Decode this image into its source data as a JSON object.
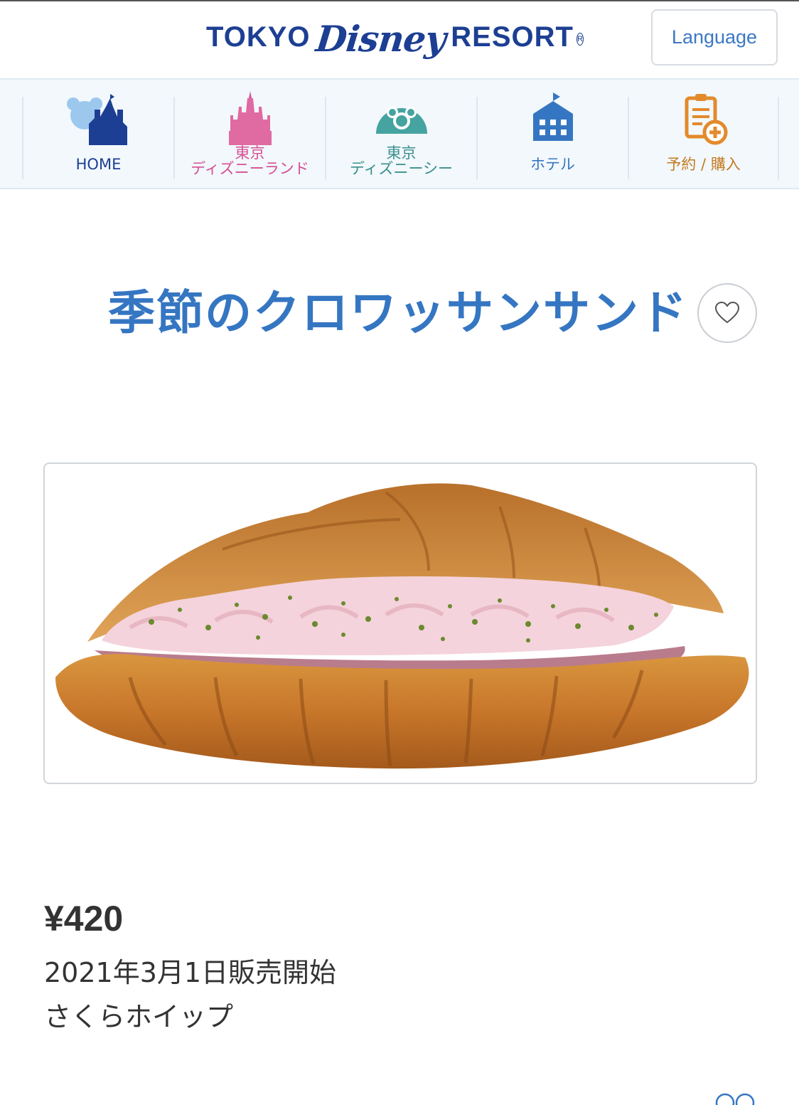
{
  "header": {
    "logo": {
      "part1": "TOKYO",
      "part2": "Disney",
      "part3": "RESORT",
      "registered": "R"
    },
    "language_label": "Language"
  },
  "nav": {
    "items": [
      {
        "label": "HOME",
        "icon": "castle-home-icon",
        "color": "#1d3f93"
      },
      {
        "label_top": "東京",
        "label_bottom": "ディズニーランド",
        "icon": "pink-castle-icon",
        "color": "#d64f93"
      },
      {
        "label_top": "東京",
        "label_bottom": "ディズニーシー",
        "icon": "mickey-globe-icon",
        "color": "#3b8f8c"
      },
      {
        "label": "ホテル",
        "icon": "hotel-icon",
        "color": "#3576c2"
      },
      {
        "label": "予約 / 購入",
        "icon": "clipboard-plus-icon",
        "color": "#c57a22"
      }
    ]
  },
  "product": {
    "title": "季節のクロワッサンサンド",
    "image_alt": "product-photo",
    "price": "¥420",
    "release": "2021年3月1日販売開始",
    "flavor": "さくらホイップ"
  },
  "colors": {
    "brand": "#1d3f93",
    "title": "#3576c2",
    "nav_bg": "#f2f8fc"
  }
}
